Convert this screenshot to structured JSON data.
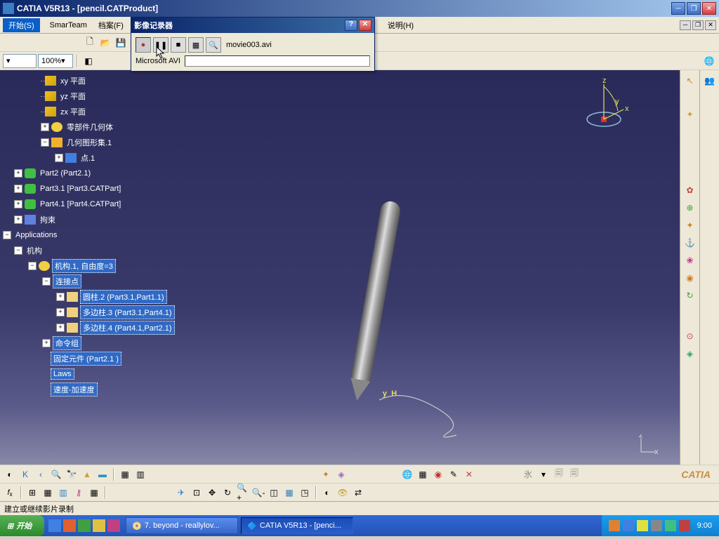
{
  "app": {
    "title": "CATIA V5R13 - [pencil.CATProduct]"
  },
  "menu": {
    "start": "开始(S)",
    "items": [
      "SmarTeam",
      "档案(F)"
    ],
    "help": "说明(H)"
  },
  "zoom": {
    "value": "100%"
  },
  "recorder": {
    "title": "影像记录器",
    "filename": "movie003.avi",
    "codec": "Microsoft AVI"
  },
  "tree": {
    "planes": [
      "xy 平面",
      "yz 平面",
      "zx 平面"
    ],
    "partbody": "零部件几何体",
    "geoset": "几何图形集.1",
    "point": "点.1",
    "part2": "Part2 (Part2.1)",
    "part3": "Part3.1 [Part3.CATPart]",
    "part4": "Part4.1 [Part4.CATPart]",
    "constraints": "拘束",
    "applications": "Applications",
    "mechanisms": "机构",
    "mechanism1": "机构.1, 自由度=3",
    "joints": "连接点",
    "joint1": "圆柱.2 (Part3.1,Part1.1)",
    "joint2": "多边柱.3 (Part3.1,Part4.1)",
    "joint3": "多边柱.4 (Part4.1,Part2.1)",
    "commands": "命令组",
    "fixed": "固定元件 (Part2.1 )",
    "laws": "Laws",
    "speeds": "速度-加速度"
  },
  "viewport": {
    "axis_h": "H",
    "compass": {
      "x": "x",
      "y": "y",
      "z": "z"
    },
    "bottom_axes": "z x"
  },
  "status": "建立或继续影片录制",
  "taskbar": {
    "start": "开始",
    "tasks": [
      "7. beyond - reallylov...",
      "CATIA V5R13 - [penci..."
    ],
    "clock": "9:00"
  },
  "catia_brand": "CATIA"
}
